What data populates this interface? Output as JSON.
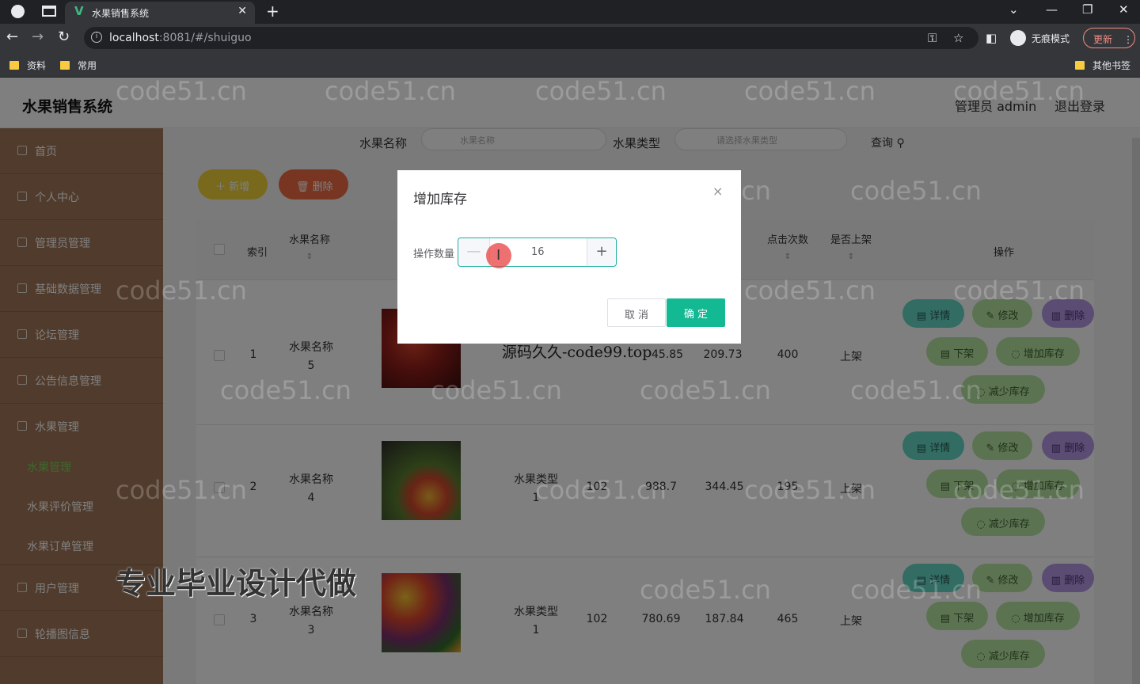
{
  "browser": {
    "tab_title": "水果销售系统",
    "tab_close": "✕",
    "new_tab": "+",
    "url_host": "localhost",
    "url_rest": ":8081/#/shuiguo",
    "profile_label": "无痕模式",
    "update_label": "更新",
    "bookmarks": [
      "资料",
      "常用"
    ],
    "other_bookmarks": "其他书签"
  },
  "app": {
    "title": "水果销售系统",
    "user": "管理员 admin",
    "logout": "退出登录"
  },
  "sidebar": {
    "items": [
      {
        "label": "首页"
      },
      {
        "label": "个人中心"
      },
      {
        "label": "管理员管理"
      },
      {
        "label": "基础数据管理"
      },
      {
        "label": "论坛管理"
      },
      {
        "label": "公告信息管理"
      },
      {
        "label": "水果管理"
      }
    ],
    "subitems": [
      {
        "label": "水果管理"
      },
      {
        "label": "水果评价管理"
      },
      {
        "label": "水果订单管理"
      }
    ],
    "items_after": [
      {
        "label": "用户管理"
      },
      {
        "label": "轮播图信息"
      }
    ]
  },
  "search": {
    "name_label": "水果名称",
    "name_placeholder": "水果名称",
    "type_label": "水果类型",
    "type_placeholder": "请选择水果类型",
    "query": "查询"
  },
  "toolbar": {
    "add": "新增",
    "delete": "删除"
  },
  "table": {
    "headers": {
      "index": "索引",
      "name": "水果名称",
      "clicks": "点击次数",
      "onshelf": "是否上架",
      "ops": "操作",
      "sort": "⇕"
    },
    "rows": [
      {
        "index": "1",
        "name": "水果名称\n5",
        "type": "",
        "stock": "",
        "price": "45.85",
        "member_price": "209.73",
        "clicks": "400",
        "onshelf": "上架"
      },
      {
        "index": "2",
        "name": "水果名称\n4",
        "type": "水果类型\n1",
        "stock": "102",
        "price": "988.7",
        "member_price": "344.45",
        "clicks": "195",
        "onshelf": "上架"
      },
      {
        "index": "3",
        "name": "水果名称\n3",
        "type": "水果类型\n1",
        "stock": "102",
        "price": "780.69",
        "member_price": "187.84",
        "clicks": "465",
        "onshelf": "上架"
      }
    ],
    "ops": {
      "detail": "详情",
      "edit": "修改",
      "delete": "删除",
      "down": "下架",
      "inc": "增加库存",
      "dec": "减少库存"
    }
  },
  "dialog": {
    "title": "增加库存",
    "close": "×",
    "label": "操作数量",
    "minus": "—",
    "plus": "+",
    "value": "16",
    "cancel": "取 消",
    "ok": "确 定"
  },
  "overlays": {
    "watermark": "code51.cn",
    "source_code": "源码久久-code99.top",
    "ad": "专业毕业设计代做"
  }
}
